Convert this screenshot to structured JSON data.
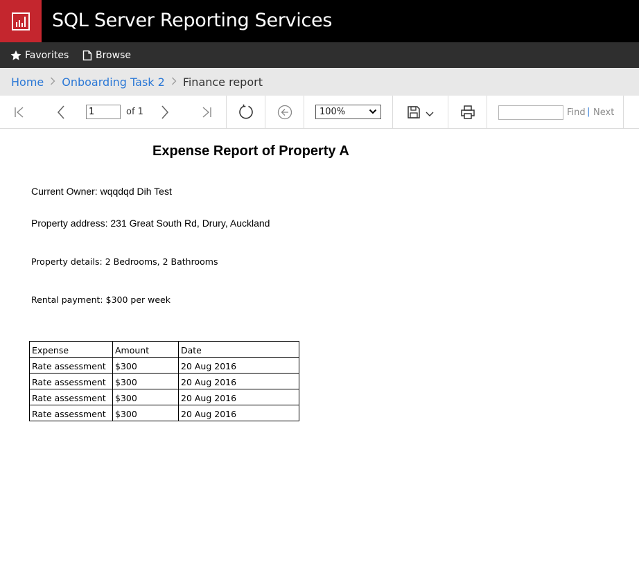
{
  "app": {
    "title": "SQL Server Reporting Services"
  },
  "nav": {
    "favorites": "Favorites",
    "browse": "Browse"
  },
  "breadcrumb": {
    "home": "Home",
    "folder": "Onboarding Task 2",
    "current": "Finance report"
  },
  "toolbar": {
    "page_value": "1",
    "of_label": "of 1",
    "zoom": "100%",
    "find_placeholder": "",
    "find_label": "Find",
    "pipe": "|",
    "next_label": "Next"
  },
  "report": {
    "title": "Expense Report of Property A",
    "owner": "Current Owner: wqqdqd Dih Test",
    "address": "Property address: 231 Great South Rd, Drury, Auckland",
    "details": "Property details: 2 Bedrooms, 2 Bathrooms",
    "rental": "Rental payment: $300 per week",
    "table": {
      "headers": [
        "Expense",
        "Amount",
        "Date"
      ],
      "rows": [
        [
          "Rate assessment",
          "$300",
          "20 Aug 2016"
        ],
        [
          "Rate assessment",
          "$300",
          "20 Aug 2016"
        ],
        [
          "Rate assessment",
          "$300",
          "20 Aug 2016"
        ],
        [
          "Rate assessment",
          "$300",
          "20 Aug 2016"
        ]
      ]
    }
  },
  "colors": {
    "brand": "#c4262e",
    "titlebar": "#000000",
    "navbar": "#2f2f2f",
    "breadcrumb_bg": "#e8e8e8",
    "link": "#2b78d6"
  },
  "icons": [
    "reporting-logo-icon",
    "star-icon",
    "document-icon",
    "first-page-icon",
    "previous-page-icon",
    "next-page-icon",
    "last-page-icon",
    "refresh-icon",
    "back-icon",
    "save-icon",
    "chevron-down-icon",
    "print-icon"
  ]
}
